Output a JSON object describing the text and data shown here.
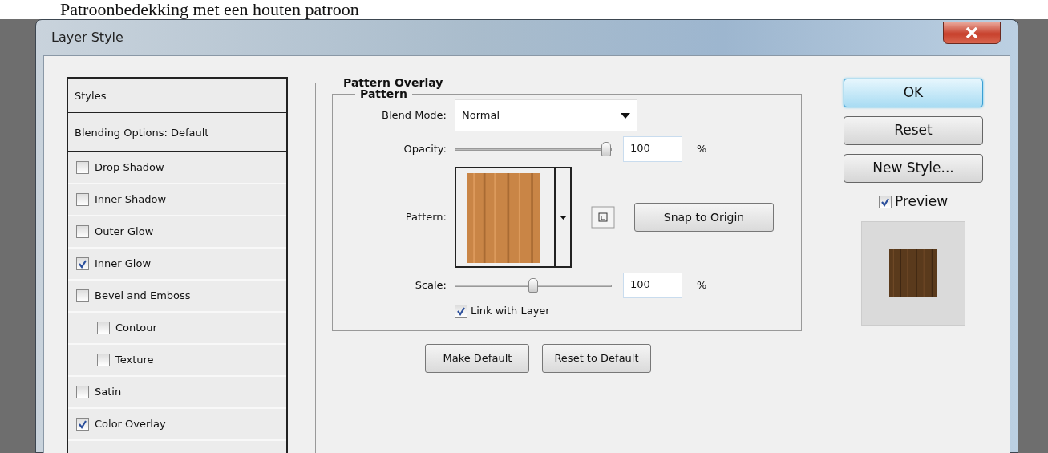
{
  "caption": "Patroonbedekking met een houten patroon",
  "window": {
    "title": "Layer Style"
  },
  "styles_panel": {
    "header": "Styles",
    "blending": "Blending Options: Default",
    "items": [
      {
        "label": "Drop Shadow",
        "checked": false
      },
      {
        "label": "Inner Shadow",
        "checked": false
      },
      {
        "label": "Outer Glow",
        "checked": false
      },
      {
        "label": "Inner Glow",
        "checked": true
      },
      {
        "label": "Bevel and Emboss",
        "checked": false,
        "children": [
          {
            "label": "Contour",
            "checked": false
          },
          {
            "label": "Texture",
            "checked": false
          }
        ]
      },
      {
        "label": "Satin",
        "checked": false
      },
      {
        "label": "Color Overlay",
        "checked": true
      }
    ]
  },
  "pattern_overlay": {
    "title": "Pattern Overlay",
    "group": "Pattern",
    "blend_mode": {
      "label": "Blend Mode:",
      "value": "Normal"
    },
    "opacity": {
      "label": "Opacity:",
      "level": 1,
      "value": "100",
      "unit": "%"
    },
    "pattern": {
      "label": "Pattern:",
      "snap_button": "Snap to Origin"
    },
    "scale": {
      "label": "Scale:",
      "level": 0.5,
      "value": "100",
      "unit": "%"
    },
    "link_with_layer": {
      "label": "Link with Layer",
      "checked": true
    },
    "buttons": [
      "Make Default",
      "Reset to Default"
    ]
  },
  "actions": {
    "buttons": [
      {
        "label": "OK",
        "kind": "default"
      },
      {
        "label": "Reset",
        "kind": "normal"
      },
      {
        "label": "New Style...",
        "kind": "normal"
      }
    ],
    "preview": {
      "label": "Preview",
      "checked": true
    }
  }
}
